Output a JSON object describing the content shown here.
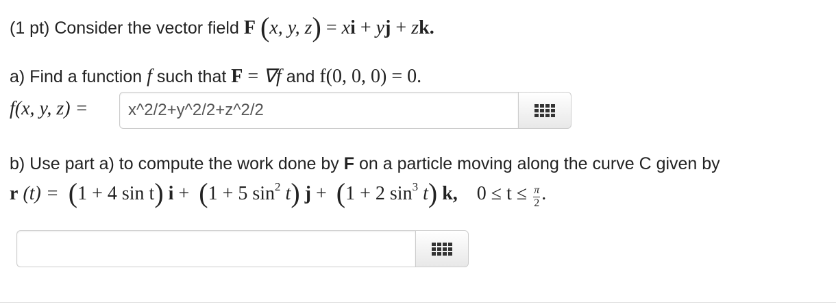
{
  "problem": {
    "points": "(1 pt)",
    "intro_text": "Consider the vector field",
    "field_def": {
      "F": "F",
      "args": "x, y, z",
      "rhs_x": "x",
      "i": "i",
      "rhs_y": "y",
      "j": "j",
      "rhs_z": "z",
      "k": "k."
    }
  },
  "part_a": {
    "prefix": "a) Find a function",
    "f": "f",
    "such_that": "such that",
    "F": "F",
    "grad": "∇f",
    "and": "and",
    "condition": "f(0, 0, 0) = 0.",
    "answer_label": "f(x, y, z) =",
    "answer_value": "x^2/2+y^2/2+z^2/2"
  },
  "part_b": {
    "text_before": "b) Use part a) to compute the work done by",
    "F": "F",
    "text_after": "on a particle moving along the curve C given by",
    "curve": {
      "r": "r",
      "t_arg": "(t) =",
      "c1": "1 + 4 sin t",
      "i": "i",
      "c2": "1 + 5 sin",
      "exp2": "2",
      "j": "j",
      "c3": "1 + 2 sin",
      "exp3": "3",
      "k": "k,",
      "range": "0 ≤ t ≤",
      "pi": "π",
      "two": "2"
    },
    "answer_value": ""
  },
  "icons": {
    "equation_editor": "grid-icon"
  }
}
